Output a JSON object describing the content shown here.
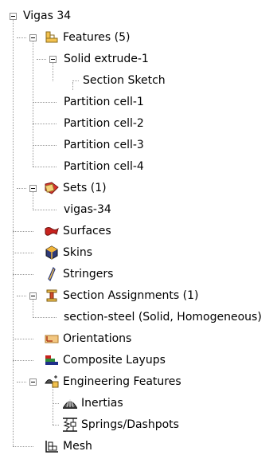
{
  "tree": {
    "root": {
      "label": "Vigas 34"
    },
    "features": {
      "label": "Features (5)",
      "icon": "features-icon",
      "children": {
        "solid_extrude": {
          "label": "Solid extrude-1",
          "children": {
            "section_sketch": {
              "label": "Section Sketch"
            }
          }
        },
        "partitions": [
          "Partition cell-1",
          "Partition cell-2",
          "Partition cell-3",
          "Partition cell-4"
        ]
      }
    },
    "sets": {
      "label": "Sets (1)",
      "icon": "sets-icon",
      "children": [
        "vigas-34"
      ]
    },
    "surfaces": {
      "label": "Surfaces",
      "icon": "surfaces-icon"
    },
    "skins": {
      "label": "Skins",
      "icon": "skins-icon"
    },
    "stringers": {
      "label": "Stringers",
      "icon": "stringers-icon"
    },
    "section_assignments": {
      "label": "Section Assignments (1)",
      "icon": "section-assignments-icon",
      "children": [
        "section-steel (Solid, Homogeneous)"
      ]
    },
    "orientations": {
      "label": "Orientations",
      "icon": "orientations-icon"
    },
    "composite_layups": {
      "label": "Composite Layups",
      "icon": "composite-layups-icon"
    },
    "engineering_features": {
      "label": "Engineering Features",
      "icon": "engineering-features-icon",
      "children": {
        "inertias": {
          "label": "Inertias",
          "icon": "inertias-icon"
        },
        "springs": {
          "label": "Springs/Dashpots",
          "icon": "springs-dashpots-icon"
        }
      }
    },
    "mesh": {
      "label": "Mesh",
      "icon": "mesh-icon"
    }
  }
}
